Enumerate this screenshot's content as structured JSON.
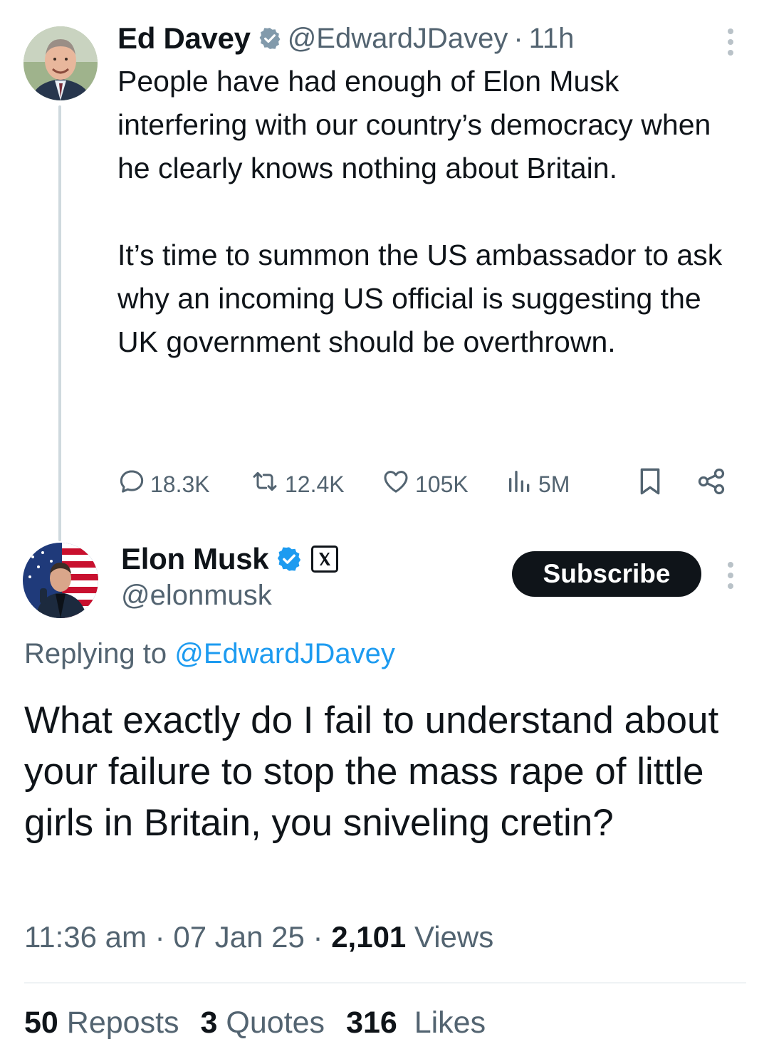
{
  "parent_tweet": {
    "author_name": "Ed Davey",
    "handle": "@EdwardJDavey",
    "separator": "·",
    "time_ago": "11h",
    "body": "People have had enough of Elon Musk interfering with our country’s democracy when he clearly knows nothing about Britain.\n\nIt’s time to summon the US ambassador to ask why an incoming US official is suggesting the UK government should be overthrown.",
    "actions": {
      "replies": "18.3K",
      "reposts": "12.4K",
      "likes": "105K",
      "views": "5M"
    },
    "badge_color": "#829aab"
  },
  "reply_tweet": {
    "author_name": "Elon Musk",
    "handle": "@elonmusk",
    "subscribe_label": "Subscribe",
    "replying_prefix": "Replying to",
    "replying_to": "@EdwardJDavey",
    "body": "What exactly do I fail to understand about your failure to stop the mass rape of little girls in Britain, you sniveling cretin?",
    "time": "11:36 am",
    "date": "07 Jan 25",
    "views_count": "2,101",
    "views_label": "Views",
    "separator": "·",
    "stats": {
      "reposts_count": "50",
      "reposts_label": "Reposts",
      "quotes_count": "3",
      "quotes_label": "Quotes",
      "likes_count": "316",
      "likes_label": "Likes"
    },
    "badge_color": "#1d9bf0"
  },
  "icons": [
    "verified-badge-icon",
    "more-icon",
    "reply-icon",
    "repost-icon",
    "like-icon",
    "views-icon",
    "bookmark-icon",
    "share-icon",
    "x-logo-icon"
  ],
  "colors": {
    "text": "#0f1419",
    "muted": "#536471",
    "link": "#1d9bf0",
    "thread_line": "#cfd9de"
  }
}
